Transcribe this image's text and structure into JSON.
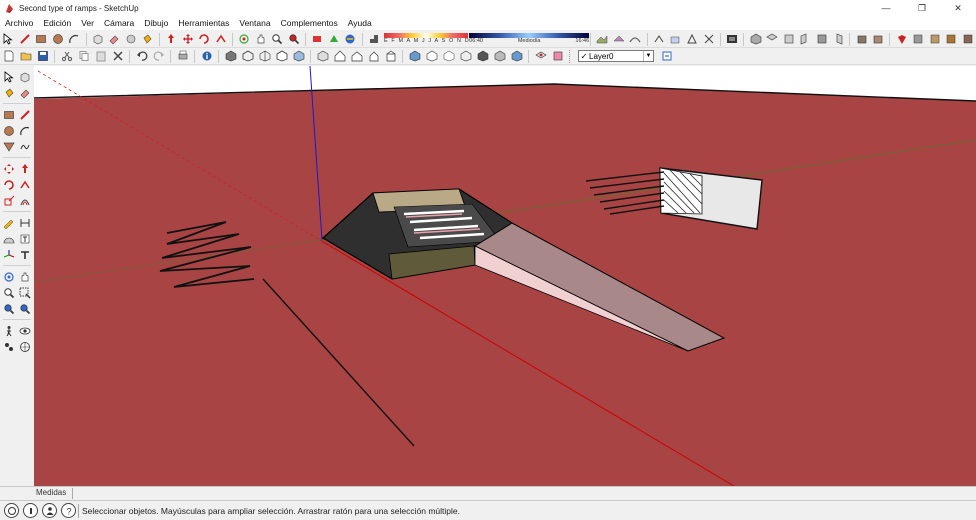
{
  "window": {
    "title": "Second type of ramps - SketchUp",
    "minimize": "—",
    "restore": "❐",
    "close": "✕"
  },
  "menu": [
    "Archivo",
    "Edición",
    "Ver",
    "Cámara",
    "Dibujo",
    "Herramientas",
    "Ventana",
    "Complementos",
    "Ayuda"
  ],
  "shadows": {
    "months": "E F M A M J J A S O N D",
    "time_start": "06:40",
    "time_mid": "Mediodía",
    "time_end": "16:46"
  },
  "layer": {
    "checked": "✓",
    "name": "Layer0",
    "arrow": "▼"
  },
  "measurements": {
    "label": "Medidas",
    "value": ""
  },
  "status": {
    "message": "Seleccionar objetos. Mayúsculas para ampliar selección. Arrastrar ratón para una selección múltiple."
  },
  "colors": {
    "ground": "#a84444",
    "sky": "#ffffff",
    "accent_red_axis": "#cc0000",
    "accent_green_axis": "#2f6b2f",
    "accent_blue_axis": "#0000cc"
  }
}
